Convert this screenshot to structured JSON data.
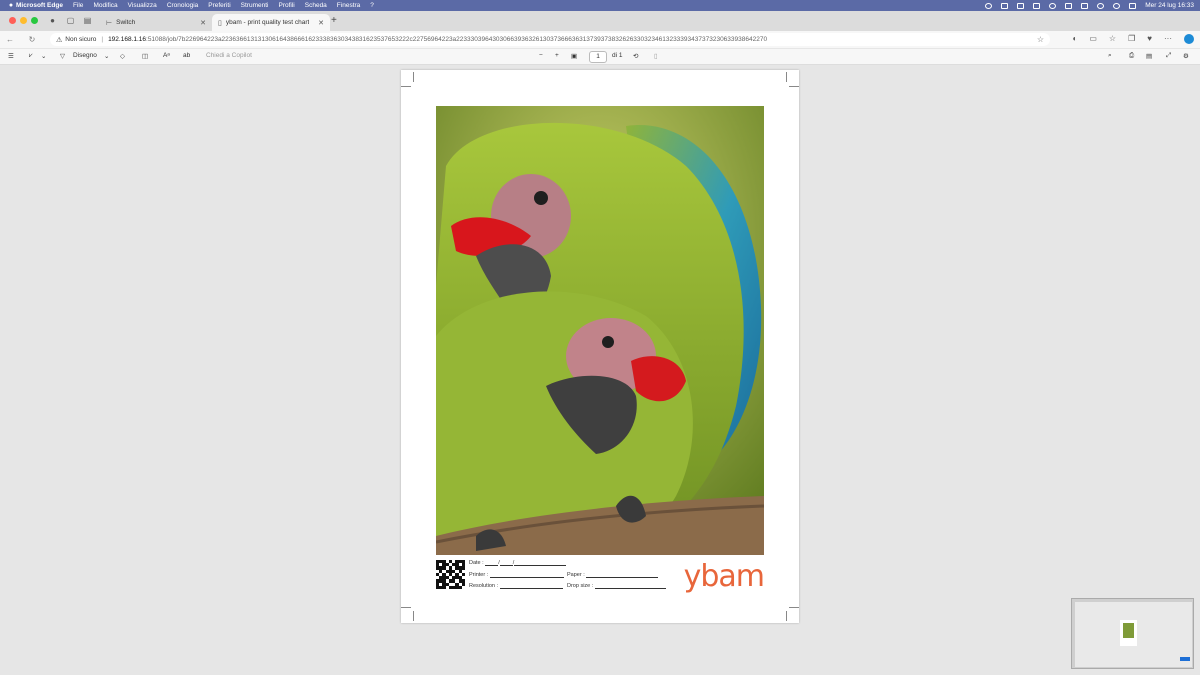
{
  "menubar": {
    "app": "Microsoft Edge",
    "items": [
      "File",
      "Modifica",
      "Visualizza",
      "Cronologia",
      "Preferiti",
      "Strumenti",
      "Profili",
      "Scheda",
      "Finestra",
      "?"
    ],
    "datetime": "Mer 24 lug  16:33"
  },
  "tabs": [
    {
      "label": "Switch",
      "active": false
    },
    {
      "label": "ybam - print quality test chart",
      "active": true
    }
  ],
  "address": {
    "security": "Non sicuro",
    "host": "192.168.1.16",
    "path": ":51088/job/7b226964223a2236366131313061643866616233383630343831623537653222c22756964223a22333039643030663936326130373666363137393738326263303234613233393437373230633938642270"
  },
  "pdf_toolbar": {
    "draw_label": "Disegno",
    "copilot_placeholder": "Chiedi a Copilot",
    "page_current": "1",
    "page_total": "di 1"
  },
  "document": {
    "footer": {
      "date_label": "Date :",
      "printer_label": "Printer :",
      "paper_label": "Paper :",
      "resolution_label": "Resolution :",
      "dropsize_label": "Drop size :",
      "brand": "ybam"
    }
  },
  "colors": {
    "menubar": "#5b6aa6",
    "brand": "#e8663b",
    "accent": "#1d8bd6"
  }
}
